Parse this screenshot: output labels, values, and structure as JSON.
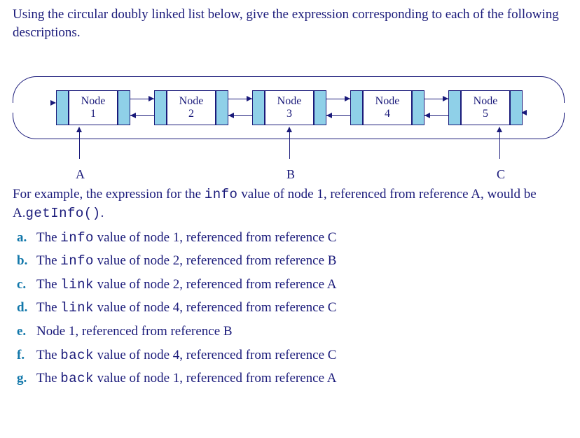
{
  "prompt": "Using the circular doubly linked list below, give the expression corresponding to each of the following descriptions.",
  "diagram": {
    "nodes": [
      {
        "label_top": "Node",
        "label_bot": "1"
      },
      {
        "label_top": "Node",
        "label_bot": "2"
      },
      {
        "label_top": "Node",
        "label_bot": "3"
      },
      {
        "label_top": "Node",
        "label_bot": "4"
      },
      {
        "label_top": "Node",
        "label_bot": "5"
      }
    ],
    "refs": {
      "A": "A",
      "B": "B",
      "C": "C"
    }
  },
  "example_pre": "For example, the expression for the ",
  "example_code1": "info",
  "example_mid": " value of node 1, referenced from reference A, would be A.",
  "example_code2": "getInfo()",
  "example_post": ".",
  "questions": [
    {
      "m": "a.",
      "pre": "The ",
      "code1": "info",
      "post": " value of node 1, referenced from reference C"
    },
    {
      "m": "b.",
      "pre": "The ",
      "code1": "info",
      "post": " value of node 2, referenced from reference B"
    },
    {
      "m": "c.",
      "pre": "The ",
      "code1": "link",
      "post": " value of node 2, referenced from reference A"
    },
    {
      "m": "d.",
      "pre": "The ",
      "code1": "link",
      "post": " value of node 4, referenced from reference C"
    },
    {
      "m": "e.",
      "pre": "Node 1, referenced from reference B",
      "code1": "",
      "post": ""
    },
    {
      "m": "f.",
      "pre": "The ",
      "code1": "back",
      "post": " value of node 4, referenced from reference C"
    },
    {
      "m": "g.",
      "pre": "The ",
      "code1": "back",
      "post": " value of node 1, referenced from reference A"
    }
  ]
}
